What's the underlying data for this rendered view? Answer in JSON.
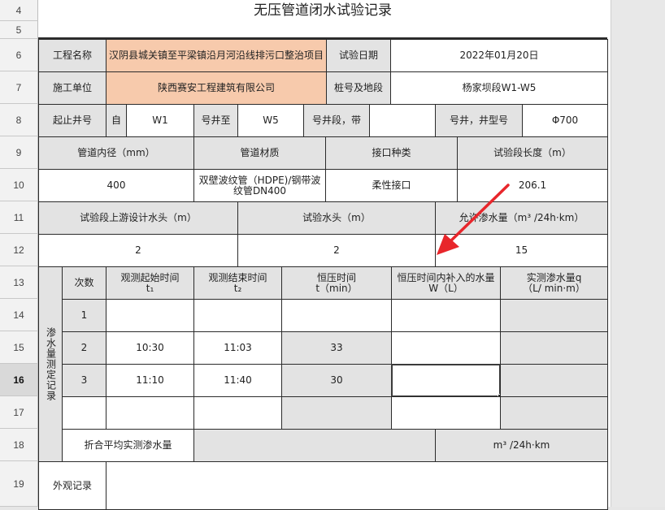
{
  "rows": [
    "4",
    "5",
    "6",
    "7",
    "8",
    "9",
    "10",
    "11",
    "12",
    "13",
    "14",
    "15",
    "16",
    "17",
    "18",
    "19"
  ],
  "selected_row": "16",
  "sheet_title": "无压管道闭水试验记录",
  "r6": {
    "label1": "工程名称",
    "project": "汉阴县城关镇至平梁镇沿月河沿线排污口整治项目",
    "label2": "试验日期",
    "date": "2022年01月20日"
  },
  "r7": {
    "label1": "施工单位",
    "company": "陕西赛安工程建筑有限公司",
    "label2": "桩号及地段",
    "segment": "杨家坝段W1-W5"
  },
  "r8": {
    "label": "起止井号",
    "from": "自",
    "start": "W1",
    "mid": "号井至",
    "end": "W5",
    "tail": "号井段，带",
    "type_label": "号井，井型号",
    "diameter": "Φ700"
  },
  "r9": {
    "h1": "管道内径（mm）",
    "h2": "管道材质",
    "h3": "接口种类",
    "h4": "试验段长度（m）"
  },
  "r10": {
    "v1": "400",
    "v2": "双壁波纹管（HDPE)/钢带波纹管DN400",
    "v3": "柔性接口",
    "v4": "206.1"
  },
  "r11": {
    "h1": "试验段上游设计水头（m）",
    "h2": "试验水头（m）",
    "h3": "允许渗水量（m³ /24h·km）"
  },
  "r12": {
    "v1": "2",
    "v2": "2",
    "v3": "15"
  },
  "r13": {
    "side": "渗水量测定记录",
    "h1": "次数",
    "h2": "观测起始时间",
    "h2s": "t₁",
    "h3": "观测结束时间",
    "h3s": "t₂",
    "h4": "恒压时间",
    "h4s": "t（min）",
    "h5": "恒压时间内补入的水量W（L）",
    "h6": "实测渗水量q",
    "h6s": "（L/ min·m）"
  },
  "r14": {
    "n": "1"
  },
  "r15": {
    "n": "2",
    "start": "10:30",
    "end": "11:03",
    "dur": "33"
  },
  "r16": {
    "n": "3",
    "start": "11:10",
    "end": "11:40",
    "dur": "30"
  },
  "r18": {
    "label": "折合平均实测渗水量",
    "unit": "m³ /24h·km"
  },
  "r19": {
    "label": "外观记录"
  },
  "annotation": {
    "color": "#e8262b",
    "icon": "arrow-icon"
  }
}
